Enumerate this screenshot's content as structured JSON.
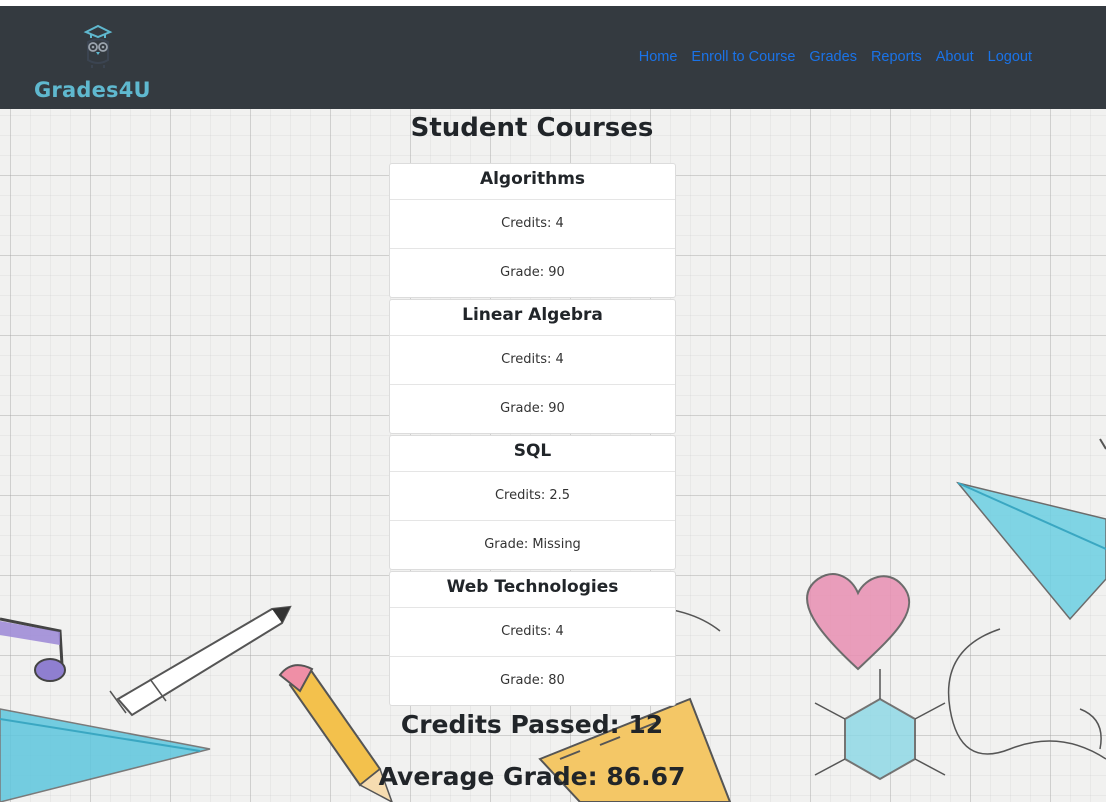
{
  "brand": {
    "name": "Grades4U",
    "logo_icon": "owl-graduate-icon",
    "accent": "#5fb8cf"
  },
  "nav": {
    "links": [
      {
        "label": "Home"
      },
      {
        "label": "Enroll to Course"
      },
      {
        "label": "Grades"
      },
      {
        "label": "Reports"
      },
      {
        "label": "About"
      },
      {
        "label": "Logout"
      }
    ],
    "link_color": "#1a73e8",
    "background": "#343a40"
  },
  "main": {
    "title": "Student Courses",
    "courses": [
      {
        "name": "Algorithms",
        "credits": "Credits: 4",
        "grade": "Grade: 90"
      },
      {
        "name": "Linear Algebra",
        "credits": "Credits: 4",
        "grade": "Grade: 90"
      },
      {
        "name": "SQL",
        "credits": "Credits: 2.5",
        "grade": "Grade: Missing"
      },
      {
        "name": "Web Technologies",
        "credits": "Credits: 4",
        "grade": "Grade: 80"
      }
    ],
    "credits_passed": "Credits Passed: 12",
    "average_grade": "Average Grade: 86.67"
  }
}
